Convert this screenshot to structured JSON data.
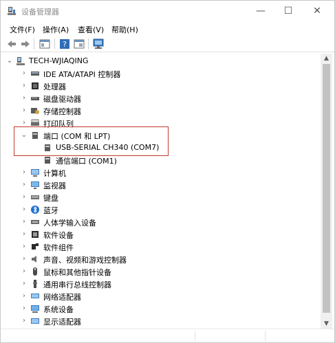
{
  "window": {
    "title": "设备管理器",
    "min_glyph": "—",
    "max_glyph": "☐",
    "close_glyph": "✕"
  },
  "menu": {
    "items": [
      "文件(F)",
      "操作(A)",
      "查看(V)",
      "帮助(H)"
    ]
  },
  "tree": {
    "root": "TECH-WJIAQING",
    "items": [
      {
        "label": "IDE ATA/ATAPI 控制器",
        "icon": "ide-controller-icon",
        "expanded": false
      },
      {
        "label": "处理器",
        "icon": "processor-icon",
        "expanded": false
      },
      {
        "label": "磁盘驱动器",
        "icon": "disk-drive-icon",
        "expanded": false
      },
      {
        "label": "存储控制器",
        "icon": "storage-controller-icon",
        "expanded": false
      },
      {
        "label": "打印队列",
        "icon": "print-queue-icon",
        "expanded": false
      },
      {
        "label": "端口 (COM 和 LPT)",
        "icon": "port-icon",
        "expanded": true
      },
      {
        "label": "USB-SERIAL CH340 (COM7)",
        "icon": "port-icon",
        "child": true
      },
      {
        "label": "通信端口 (COM1)",
        "icon": "port-icon",
        "child": true
      },
      {
        "label": "计算机",
        "icon": "computer-icon",
        "expanded": false
      },
      {
        "label": "监视器",
        "icon": "monitor-icon",
        "expanded": false
      },
      {
        "label": "键盘",
        "icon": "keyboard-icon",
        "expanded": false
      },
      {
        "label": "蓝牙",
        "icon": "bluetooth-icon",
        "expanded": false
      },
      {
        "label": "人体学输入设备",
        "icon": "hid-icon",
        "expanded": false
      },
      {
        "label": "软件设备",
        "icon": "software-device-icon",
        "expanded": false
      },
      {
        "label": "软件组件",
        "icon": "software-component-icon",
        "expanded": false
      },
      {
        "label": "声音、视频和游戏控制器",
        "icon": "sound-icon",
        "expanded": false
      },
      {
        "label": "鼠标和其他指针设备",
        "icon": "mouse-icon",
        "expanded": false
      },
      {
        "label": "通用串行总线控制器",
        "icon": "usb-icon",
        "expanded": false
      },
      {
        "label": "网络适配器",
        "icon": "network-adapter-icon",
        "expanded": false
      },
      {
        "label": "系统设备",
        "icon": "system-device-icon",
        "expanded": false
      },
      {
        "label": "显示适配器",
        "icon": "display-adapter-icon",
        "expanded": false
      }
    ]
  },
  "colors": {
    "highlight": "#c0392b",
    "accent": "#0078d7"
  }
}
